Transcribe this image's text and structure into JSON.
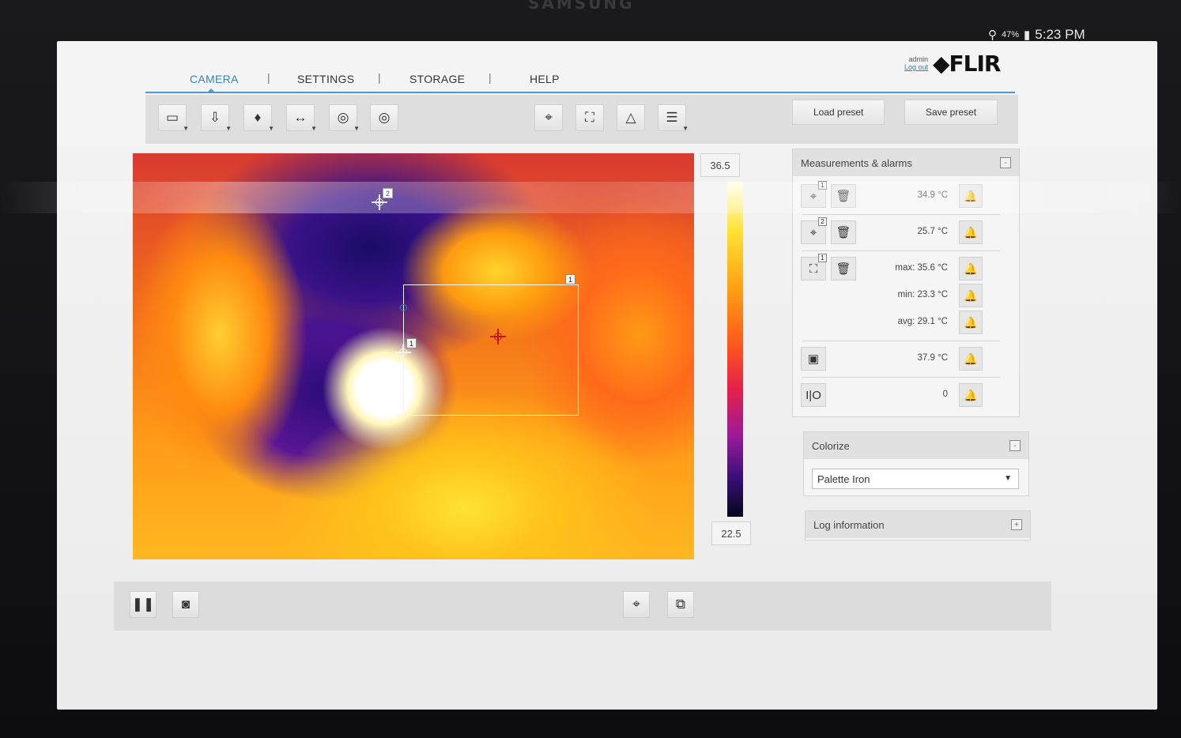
{
  "device": {
    "brand": "SAMSUNG"
  },
  "status_bar": {
    "battery": "47%",
    "time": "5:23 PM"
  },
  "header": {
    "user": "admin",
    "logout": "Log out",
    "logo": "FLIR"
  },
  "nav": {
    "tabs": [
      "CAMERA",
      "SETTINGS",
      "STORAGE",
      "HELP"
    ],
    "active": "CAMERA"
  },
  "toolbar": {
    "tools": [
      "display-mode-icon",
      "focus-icon",
      "lamp-icon",
      "fusion-icon",
      "zoom-ring-icon",
      "focus-ring-icon",
      "spot-meter-icon",
      "box-measure-icon",
      "delta-icon",
      "adjust-icon"
    ],
    "load_preset": "Load preset",
    "save_preset": "Save preset"
  },
  "image": {
    "scale_max": "36.5",
    "scale_min": "22.5",
    "overlay_labels": [
      "2",
      "1",
      "1"
    ]
  },
  "measurements": {
    "title": "Measurements & alarms",
    "collapse": "-",
    "rows": [
      {
        "icon": "spot-meter-icon",
        "index": "1",
        "value": "34.9 °C"
      },
      {
        "icon": "spot-meter-icon",
        "index": "2",
        "value": "25.7 °C"
      },
      {
        "icon": "box-measure-icon",
        "index": "1",
        "max": "max: 35.6 °C",
        "min": "min: 23.3 °C",
        "avg": "avg: 29.1 °C"
      },
      {
        "icon": "internal-temp-icon",
        "value": "37.9 °C"
      },
      {
        "icon": "digital-io-icon",
        "value": "0"
      }
    ]
  },
  "colorize": {
    "title": "Colorize",
    "collapse": "-",
    "palette": "Palette Iron"
  },
  "log": {
    "title": "Log information",
    "expand": "+"
  }
}
